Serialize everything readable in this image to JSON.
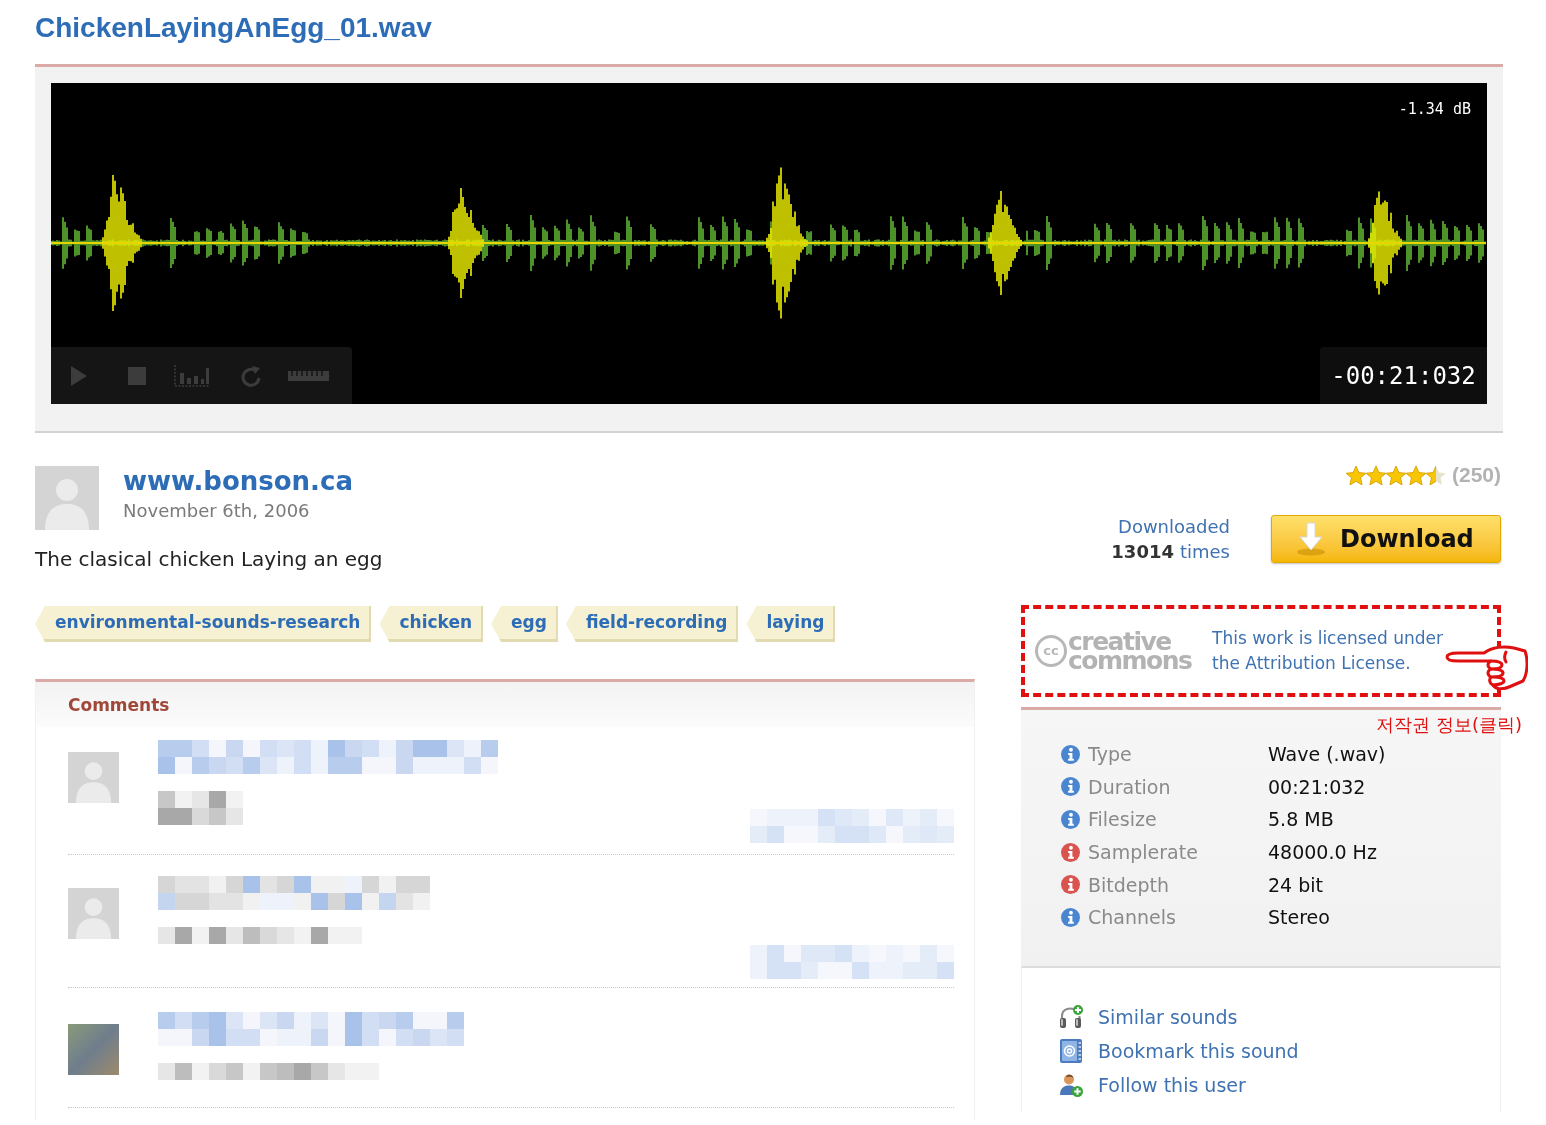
{
  "title": "ChickenLayingAnEgg_01.wav",
  "player": {
    "peak": "-1.34 dB",
    "time": "-00:21:032"
  },
  "uploader": {
    "name": "www.bonson.ca",
    "date": "November 6th, 2006"
  },
  "description": "The clasical chicken Laying an egg",
  "tags": [
    "environmental-sounds-research",
    "chicken",
    "egg",
    "field-recording",
    "laying"
  ],
  "comments": {
    "title": "Comments",
    "items": [
      {
        "kind": "silhouette"
      },
      {
        "kind": "silhouette"
      },
      {
        "kind": "photo"
      }
    ]
  },
  "rating": {
    "stars": 4.5,
    "count": "(250)"
  },
  "downloads": {
    "label": "Downloaded",
    "count": "13014",
    "suffix": "times"
  },
  "download_button": {
    "label": "Download"
  },
  "license": {
    "logo_mark": "cc",
    "logo_lines": [
      "creative",
      "commons"
    ],
    "text": "This work is licensed under the Attribution License."
  },
  "annotation": {
    "label": "저작권 정보(클릭)"
  },
  "file_info": [
    {
      "label": "Type",
      "value": "Wave (.wav)",
      "color": "#4a86d0"
    },
    {
      "label": "Duration",
      "value": "00:21:032",
      "color": "#4a86d0"
    },
    {
      "label": "Filesize",
      "value": "5.8 MB",
      "color": "#4a86d0"
    },
    {
      "label": "Samplerate",
      "value": "48000.0 Hz",
      "color": "#d9534f"
    },
    {
      "label": "Bitdepth",
      "value": "24 bit",
      "color": "#d9534f"
    },
    {
      "label": "Channels",
      "value": "Stereo",
      "color": "#4a86d0"
    }
  ],
  "actions": [
    "Similar sounds",
    "Bookmark this sound",
    "Follow this user"
  ]
}
